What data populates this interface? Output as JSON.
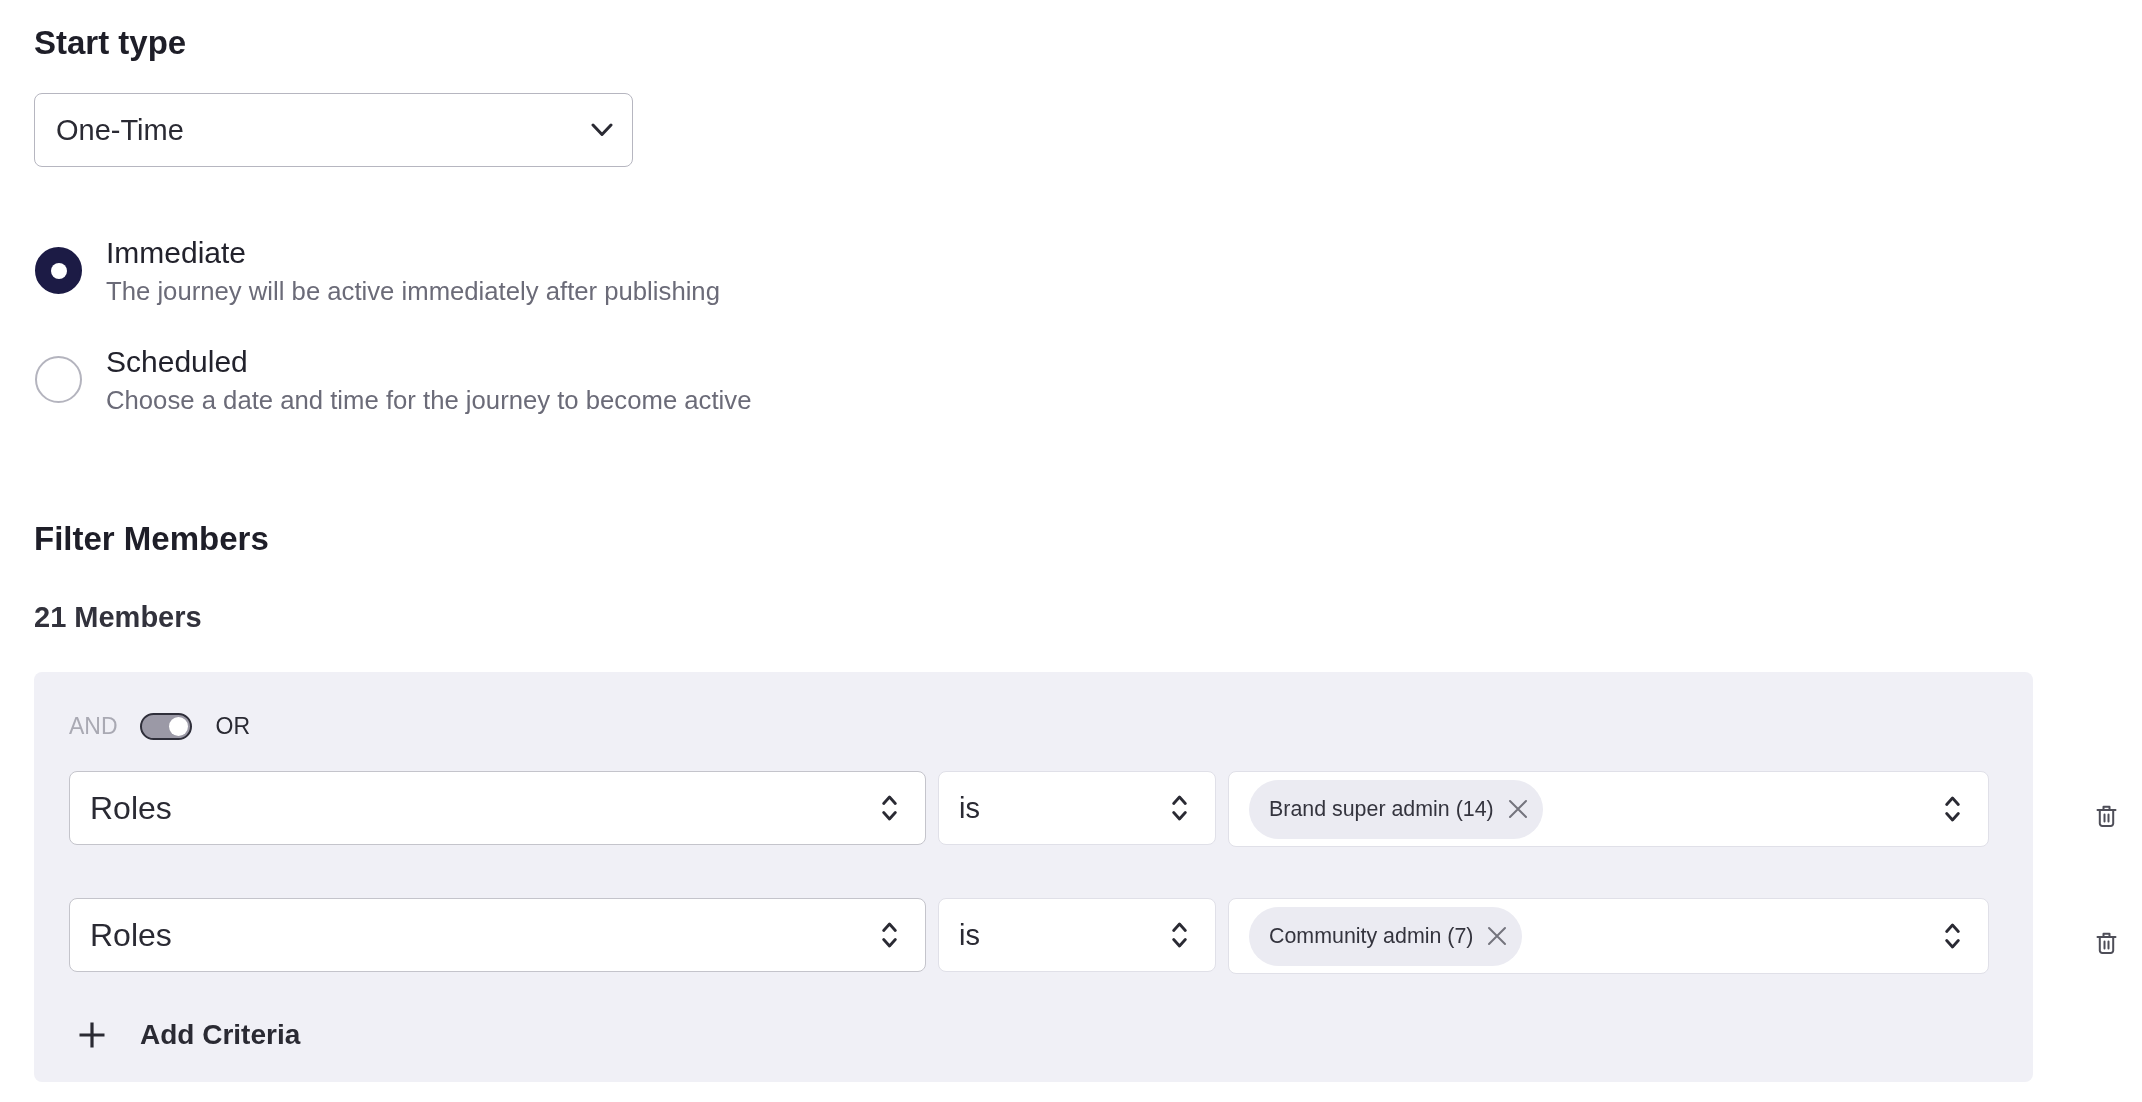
{
  "start_type": {
    "heading": "Start type",
    "dropdown": {
      "value": "One-Time"
    },
    "options": [
      {
        "label": "Immediate",
        "description": "The journey will be active immediately after publishing",
        "selected": true
      },
      {
        "label": "Scheduled",
        "description": "Choose a date and time for the journey to become active",
        "selected": false
      }
    ]
  },
  "filter": {
    "heading": "Filter Members",
    "member_count": "21 Members",
    "logic_toggle": {
      "left_label": "AND",
      "right_label": "OR",
      "on": true
    },
    "criteria": [
      {
        "field": "Roles",
        "operator": "is",
        "values": [
          "Brand super admin (14)"
        ]
      },
      {
        "field": "Roles",
        "operator": "is",
        "values": [
          "Community admin (7)"
        ]
      }
    ],
    "add_button": "Add Criteria"
  }
}
